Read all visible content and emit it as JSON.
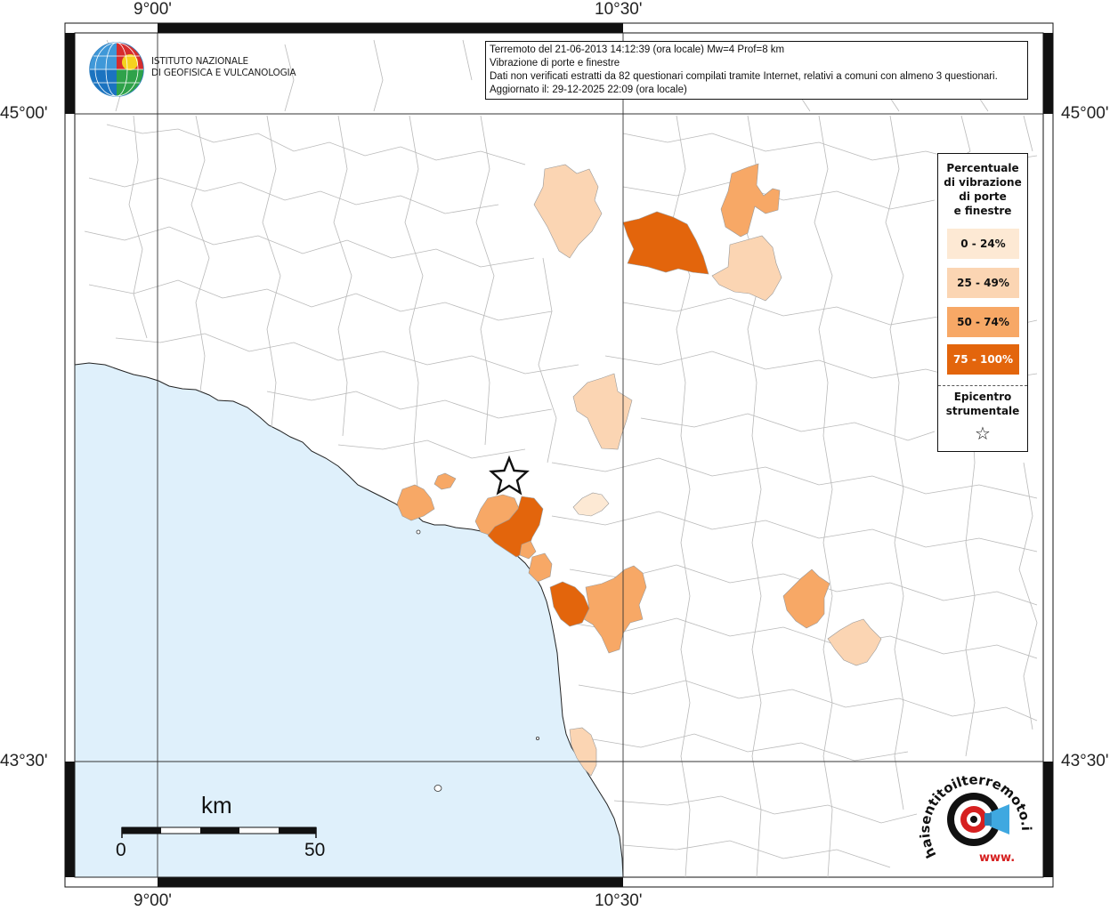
{
  "header": {
    "title_line": "Terremoto del 21-06-2013 14:12:39 (ora locale) Mw=4 Prof=8 km",
    "subtitle_line": "Vibrazione di porte e finestre",
    "data_line": "Dati non verificati estratti da 82 questionari compilati tramite Internet, relativi a comuni con almeno 3 questionari.",
    "update_line": "Aggiornato il: 29-12-2025 22:09 (ora locale)"
  },
  "logo": {
    "line1": "ISTITUTO NAZIONALE",
    "line2": "DI GEOFISICA E VULCANOLOGIA",
    "icon": "ingv-globe-icon"
  },
  "axes": {
    "top_lon_left": "9°00'",
    "top_lon_right": "10°30'",
    "bottom_lon_left": "9°00'",
    "bottom_lon_right": "10°30'",
    "left_lat_top": "45°00'",
    "left_lat_bottom": "43°30'",
    "right_lat_top": "45°00'",
    "right_lat_bottom": "43°30'"
  },
  "legend": {
    "title_line1": "Percentuale",
    "title_line2": "di vibrazione",
    "title_line3": "di porte",
    "title_line4": "e finestre",
    "classes": [
      {
        "label": "0 - 24%",
        "color": "#fde9d4",
        "text_color": "#111111"
      },
      {
        "label": "25 - 49%",
        "color": "#fbd5b3",
        "text_color": "#111111"
      },
      {
        "label": "50 - 74%",
        "color": "#f7a866",
        "text_color": "#111111"
      },
      {
        "label": "75 - 100%",
        "color": "#e3650c",
        "text_color": "#ffffff"
      }
    ],
    "epicenter_line1": "Epicentro",
    "epicenter_line2": "strumentale",
    "epicenter_symbol": "☆"
  },
  "scale": {
    "unit": "km",
    "start": "0",
    "end": "50"
  },
  "haisentito": {
    "text": "haisentitoilterremoto.it",
    "url_text": "www.",
    "icon": "haisentito-target-icon"
  },
  "colors": {
    "sea": "#dff0fb",
    "land": "#ffffff",
    "border": "#b9b9b9"
  }
}
